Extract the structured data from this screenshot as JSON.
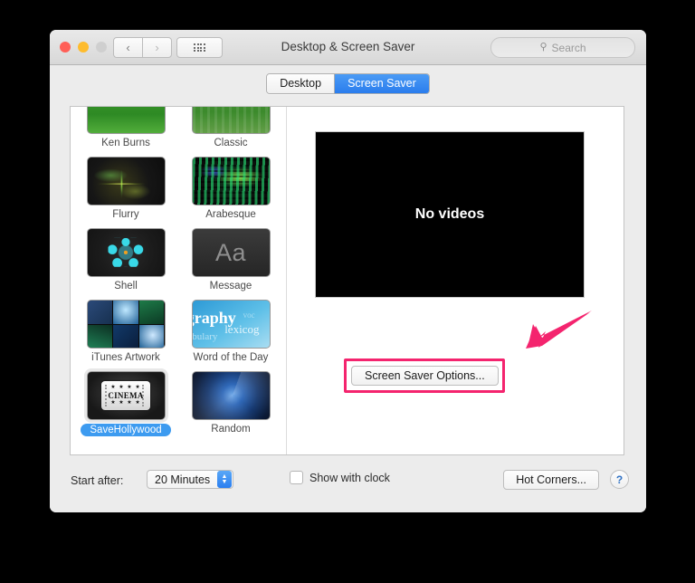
{
  "window": {
    "title": "Desktop & Screen Saver",
    "traffic_lights": [
      "close",
      "minimize",
      "zoom"
    ],
    "nav": {
      "back": "‹",
      "forward": "›"
    },
    "grid_button": "all-preferences"
  },
  "search": {
    "placeholder": "Search",
    "icon": "search-icon"
  },
  "tabs": [
    {
      "label": "Desktop",
      "active": false
    },
    {
      "label": "Screen Saver",
      "active": true
    }
  ],
  "saver_list": {
    "rows": [
      [
        {
          "label": "Ken Burns",
          "art": "art-kenburns",
          "selected": false
        },
        {
          "label": "Classic",
          "art": "art-classic",
          "selected": false
        }
      ],
      [
        {
          "label": "Flurry",
          "art": "art-flurry",
          "selected": false
        },
        {
          "label": "Arabesque",
          "art": "art-arabesque",
          "selected": false
        }
      ],
      [
        {
          "label": "Shell",
          "art": "art-shell",
          "selected": false
        },
        {
          "label": "Message",
          "art": "art-message",
          "art_text": "Aa",
          "selected": false
        }
      ],
      [
        {
          "label": "iTunes Artwork",
          "art": "art-itunes",
          "selected": false
        },
        {
          "label": "Word of the Day",
          "art": "art-word",
          "selected": false
        }
      ],
      [
        {
          "label": "SaveHollywood",
          "art": "art-hollywood",
          "selected": true
        },
        {
          "label": "Random",
          "art": "art-random",
          "selected": false
        }
      ]
    ],
    "hollywood_ticket": {
      "stars_top": "★ ★ ★ ★",
      "title": "CINEMA",
      "stars_bottom": "★ ★ ★ ★"
    },
    "word_of_day_words": {
      "w1": "graphy",
      "w2": "lexicog",
      "w3": "abulary",
      "w4": "voc"
    }
  },
  "preview": {
    "message": "No videos",
    "options_button": "Screen Saver Options..."
  },
  "bottom": {
    "start_after_label": "Start after:",
    "start_after_value": "20 Minutes",
    "show_clock_label": "Show with clock",
    "show_clock_checked": false,
    "hot_corners_button": "Hot Corners...",
    "help_button": "?"
  },
  "annotation": {
    "highlight_color": "#f4246e",
    "target": "Screen Saver Options..."
  }
}
